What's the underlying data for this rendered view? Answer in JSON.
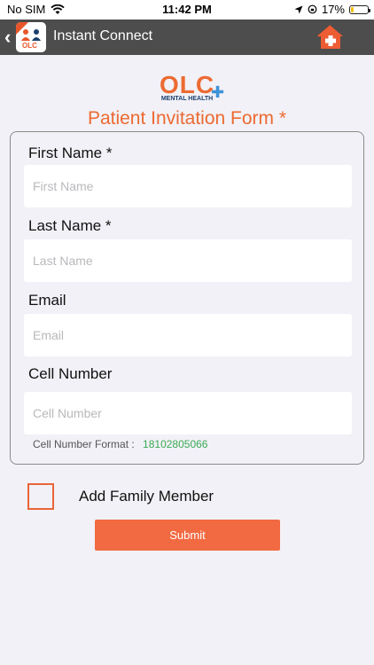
{
  "status_bar": {
    "carrier": "No SIM",
    "time": "11:42 PM",
    "battery": "17%",
    "battery_level": 0.17
  },
  "nav": {
    "title": "Instant Connect",
    "logo_text": "OLC"
  },
  "brand": {
    "logo_text": "OLC",
    "logo_subtext": "MENTAL HEALTH"
  },
  "form": {
    "title": "Patient Invitation Form *",
    "fields": [
      {
        "label": "First Name *",
        "placeholder": "First Name",
        "value": ""
      },
      {
        "label": "Last Name *",
        "placeholder": "Last Name",
        "value": ""
      },
      {
        "label": "Email",
        "placeholder": "Email",
        "value": ""
      },
      {
        "label": "Cell Number",
        "placeholder": "Cell Number",
        "value": ""
      }
    ],
    "cell_format_label": "Cell Number Format :",
    "cell_format_value": "18102805066",
    "family_member_label": "Add Family Member",
    "family_member_checked": false,
    "submit_label": "Submit"
  },
  "colors": {
    "accent": "#f26a42",
    "navbar": "#4d4d4d",
    "format_value": "#3aab54"
  }
}
